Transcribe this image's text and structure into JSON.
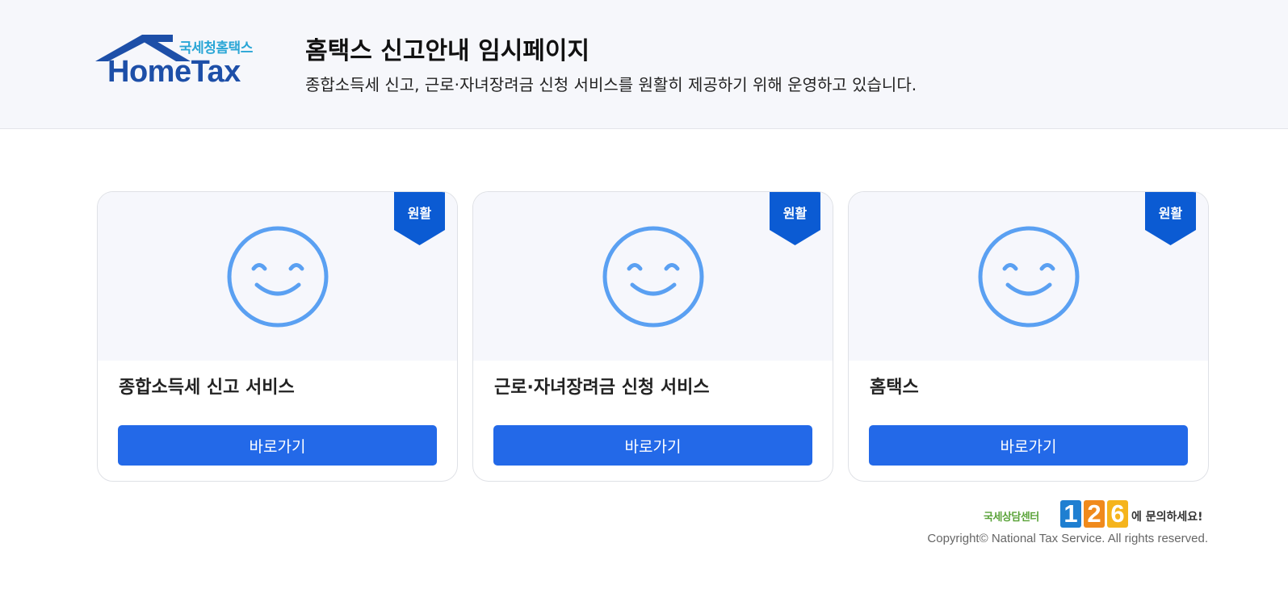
{
  "header": {
    "logo_sub": "국세청홈택스",
    "logo_main": "HomeTax",
    "title": "홈택스 신고안내 임시페이지",
    "description": "종합소득세 신고, 근로·자녀장려금 신청 서비스를 원활히 제공하기 위해 운영하고 있습니다."
  },
  "cards": [
    {
      "status": "원활",
      "title": "종합소득세 신고 서비스",
      "button": "바로가기",
      "icon": "smile-icon"
    },
    {
      "status": "원활",
      "title": "근로·자녀장려금 신청 서비스",
      "button": "바로가기",
      "icon": "smile-icon"
    },
    {
      "status": "원활",
      "title": "홈택스",
      "button": "바로가기",
      "icon": "smile-icon"
    }
  ],
  "footer": {
    "contact_pre": "국세상담센터",
    "contact_digits": [
      "1",
      "2",
      "6"
    ],
    "contact_post": "에 문의하세요!",
    "copyright": "Copyright© National Tax Service. All rights reserved."
  },
  "colors": {
    "header_bg": "#f6f7fb",
    "primary_button": "#2369e8",
    "ribbon": "#0b5bd3",
    "smile": "#5aa0f2",
    "logo_blue": "#1d4fa8",
    "logo_sub": "#2aa6d6"
  }
}
